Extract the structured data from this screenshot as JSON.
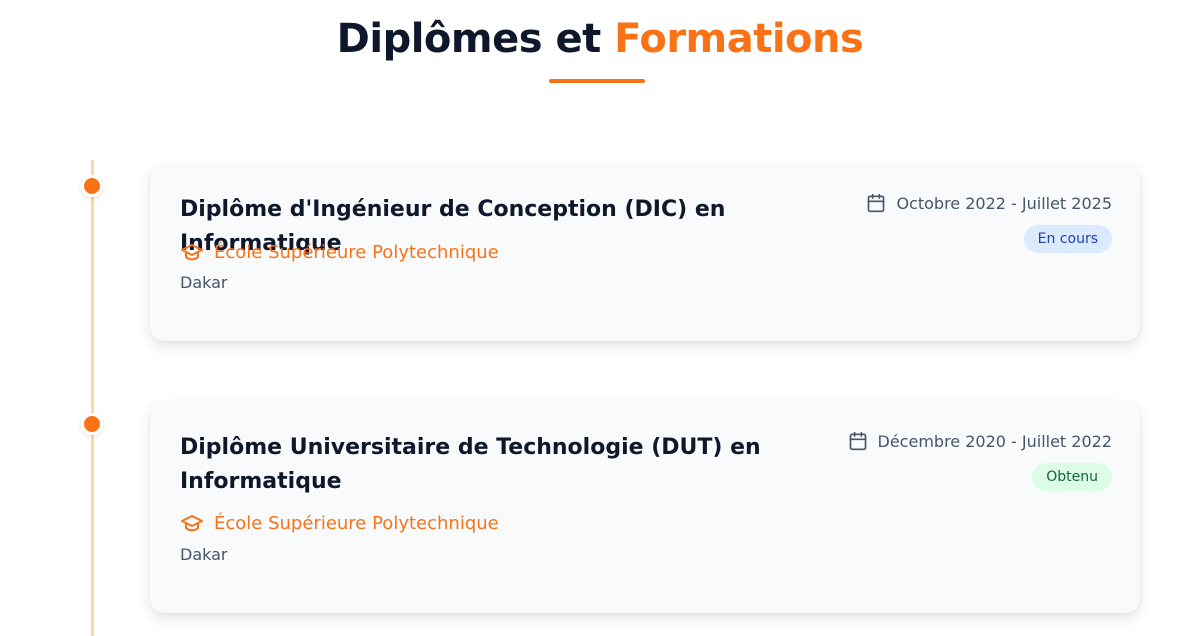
{
  "header": {
    "title_part1": "Diplômes et",
    "title_part2": "Formations"
  },
  "colors": {
    "accent": "#f97316",
    "timeline": "#fcd9a4",
    "badge_in_progress_bg": "#dbeafe",
    "badge_obtained_bg": "#dcfce7"
  },
  "education": [
    {
      "title": "Diplôme d'Ingénieur de Conception (DIC) en Informatique",
      "school": "École Supérieure Polytechnique",
      "location": "Dakar",
      "dates": "Octobre 2022 - Juillet 2025",
      "status": "En cours",
      "school_icon": "graduation-cap-icon",
      "date_icon": "calendar-icon"
    },
    {
      "title": "Diplôme Universitaire de Technologie (DUT) en Informatique",
      "school": "École Supérieure Polytechnique",
      "location": "Dakar",
      "dates": "Décembre 2020 - Juillet 2022",
      "status": "Obtenu",
      "school_icon": "graduation-cap-icon",
      "date_icon": "calendar-icon"
    }
  ]
}
